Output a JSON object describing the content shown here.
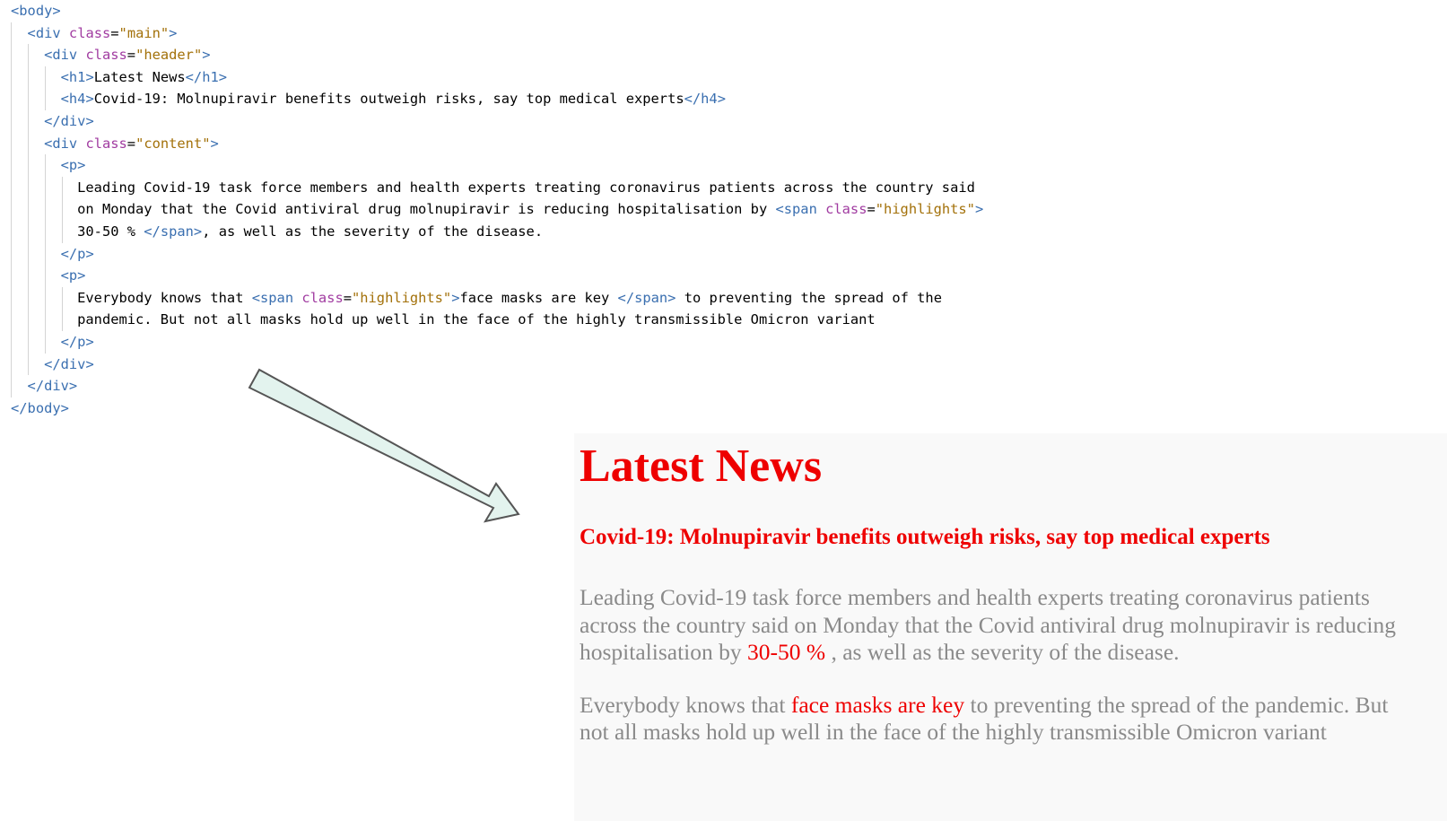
{
  "code": {
    "body_open": "body",
    "body_close": "body",
    "div_tag": "div",
    "h1_tag": "h1",
    "h4_tag": "h4",
    "p_tag": "p",
    "span_tag": "span",
    "class_attr": "class",
    "main_class": "\"main\"",
    "header_class": "\"header\"",
    "content_class": "\"content\"",
    "highlights_class": "\"highlights\"",
    "h1_text": "Latest News",
    "h4_text": "Covid-19: Molnupiravir benefits outweigh risks, say top medical experts",
    "p1_line1": "Leading Covid-19 task force members and health experts treating coronavirus patients across the country said",
    "p1_line2": "on Monday that the Covid antiviral drug molnupiravir is reducing hospitalisation by ",
    "p1_line3_hl": "30-50 % ",
    "p1_line3_rest": ", as well as the severity of the disease.",
    "p2_line1_a": "Everybody knows that ",
    "p2_line1_hl": "face masks are key ",
    "p2_line1_b": " to preventing the spread of the",
    "p2_line2": "pandemic. But not all masks hold up well in the face of the highly transmissible Omicron variant"
  },
  "preview": {
    "title": "Latest News",
    "subtitle": "Covid-19: Molnupiravir benefits outweigh risks, say top medical experts",
    "p1_before": "Leading Covid-19 task force members and health experts treating coronavirus patients across the country said on Monday that the Covid antiviral drug molnupiravir is reducing hospitalisation by ",
    "p1_highlight": "30-50 % ",
    "p1_after": ", as well as the severity of the disease.",
    "p2_before": "Everybody knows that ",
    "p2_highlight": "face masks are key ",
    "p2_after": "to preventing the spread of the pandemic. But not all masks hold up well in the face of the highly transmissible Omicron variant"
  },
  "colors": {
    "heading_red": "#ee0000",
    "body_gray": "#8a8a8a",
    "preview_bg": "#f9f9f9",
    "arrow_fill": "#e3f3ee"
  },
  "icons": {
    "arrow": "arrow-down-right-icon"
  }
}
